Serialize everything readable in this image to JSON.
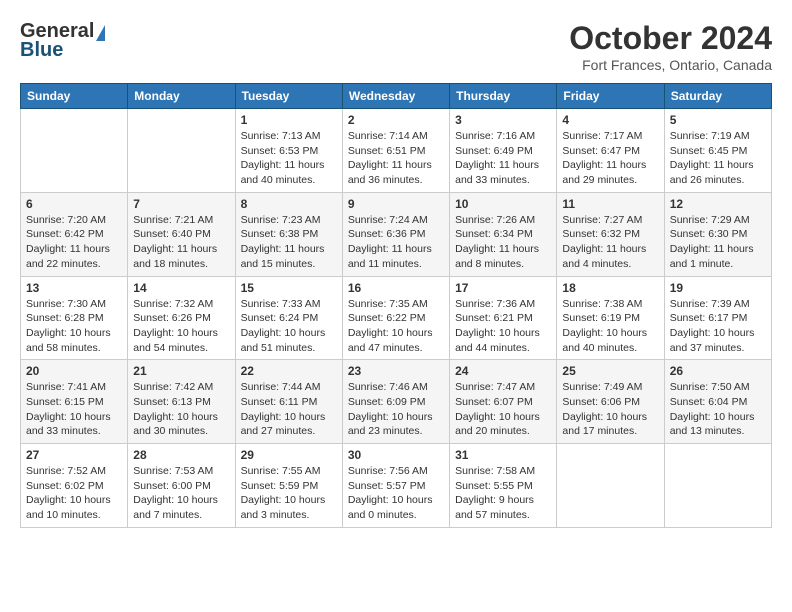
{
  "header": {
    "logo_general": "General",
    "logo_blue": "Blue",
    "month_title": "October 2024",
    "location": "Fort Frances, Ontario, Canada"
  },
  "weekdays": [
    "Sunday",
    "Monday",
    "Tuesday",
    "Wednesday",
    "Thursday",
    "Friday",
    "Saturday"
  ],
  "weeks": [
    [
      {
        "day": "",
        "info": ""
      },
      {
        "day": "",
        "info": ""
      },
      {
        "day": "1",
        "info": "Sunrise: 7:13 AM\nSunset: 6:53 PM\nDaylight: 11 hours and 40 minutes."
      },
      {
        "day": "2",
        "info": "Sunrise: 7:14 AM\nSunset: 6:51 PM\nDaylight: 11 hours and 36 minutes."
      },
      {
        "day": "3",
        "info": "Sunrise: 7:16 AM\nSunset: 6:49 PM\nDaylight: 11 hours and 33 minutes."
      },
      {
        "day": "4",
        "info": "Sunrise: 7:17 AM\nSunset: 6:47 PM\nDaylight: 11 hours and 29 minutes."
      },
      {
        "day": "5",
        "info": "Sunrise: 7:19 AM\nSunset: 6:45 PM\nDaylight: 11 hours and 26 minutes."
      }
    ],
    [
      {
        "day": "6",
        "info": "Sunrise: 7:20 AM\nSunset: 6:42 PM\nDaylight: 11 hours and 22 minutes."
      },
      {
        "day": "7",
        "info": "Sunrise: 7:21 AM\nSunset: 6:40 PM\nDaylight: 11 hours and 18 minutes."
      },
      {
        "day": "8",
        "info": "Sunrise: 7:23 AM\nSunset: 6:38 PM\nDaylight: 11 hours and 15 minutes."
      },
      {
        "day": "9",
        "info": "Sunrise: 7:24 AM\nSunset: 6:36 PM\nDaylight: 11 hours and 11 minutes."
      },
      {
        "day": "10",
        "info": "Sunrise: 7:26 AM\nSunset: 6:34 PM\nDaylight: 11 hours and 8 minutes."
      },
      {
        "day": "11",
        "info": "Sunrise: 7:27 AM\nSunset: 6:32 PM\nDaylight: 11 hours and 4 minutes."
      },
      {
        "day": "12",
        "info": "Sunrise: 7:29 AM\nSunset: 6:30 PM\nDaylight: 11 hours and 1 minute."
      }
    ],
    [
      {
        "day": "13",
        "info": "Sunrise: 7:30 AM\nSunset: 6:28 PM\nDaylight: 10 hours and 58 minutes."
      },
      {
        "day": "14",
        "info": "Sunrise: 7:32 AM\nSunset: 6:26 PM\nDaylight: 10 hours and 54 minutes."
      },
      {
        "day": "15",
        "info": "Sunrise: 7:33 AM\nSunset: 6:24 PM\nDaylight: 10 hours and 51 minutes."
      },
      {
        "day": "16",
        "info": "Sunrise: 7:35 AM\nSunset: 6:22 PM\nDaylight: 10 hours and 47 minutes."
      },
      {
        "day": "17",
        "info": "Sunrise: 7:36 AM\nSunset: 6:21 PM\nDaylight: 10 hours and 44 minutes."
      },
      {
        "day": "18",
        "info": "Sunrise: 7:38 AM\nSunset: 6:19 PM\nDaylight: 10 hours and 40 minutes."
      },
      {
        "day": "19",
        "info": "Sunrise: 7:39 AM\nSunset: 6:17 PM\nDaylight: 10 hours and 37 minutes."
      }
    ],
    [
      {
        "day": "20",
        "info": "Sunrise: 7:41 AM\nSunset: 6:15 PM\nDaylight: 10 hours and 33 minutes."
      },
      {
        "day": "21",
        "info": "Sunrise: 7:42 AM\nSunset: 6:13 PM\nDaylight: 10 hours and 30 minutes."
      },
      {
        "day": "22",
        "info": "Sunrise: 7:44 AM\nSunset: 6:11 PM\nDaylight: 10 hours and 27 minutes."
      },
      {
        "day": "23",
        "info": "Sunrise: 7:46 AM\nSunset: 6:09 PM\nDaylight: 10 hours and 23 minutes."
      },
      {
        "day": "24",
        "info": "Sunrise: 7:47 AM\nSunset: 6:07 PM\nDaylight: 10 hours and 20 minutes."
      },
      {
        "day": "25",
        "info": "Sunrise: 7:49 AM\nSunset: 6:06 PM\nDaylight: 10 hours and 17 minutes."
      },
      {
        "day": "26",
        "info": "Sunrise: 7:50 AM\nSunset: 6:04 PM\nDaylight: 10 hours and 13 minutes."
      }
    ],
    [
      {
        "day": "27",
        "info": "Sunrise: 7:52 AM\nSunset: 6:02 PM\nDaylight: 10 hours and 10 minutes."
      },
      {
        "day": "28",
        "info": "Sunrise: 7:53 AM\nSunset: 6:00 PM\nDaylight: 10 hours and 7 minutes."
      },
      {
        "day": "29",
        "info": "Sunrise: 7:55 AM\nSunset: 5:59 PM\nDaylight: 10 hours and 3 minutes."
      },
      {
        "day": "30",
        "info": "Sunrise: 7:56 AM\nSunset: 5:57 PM\nDaylight: 10 hours and 0 minutes."
      },
      {
        "day": "31",
        "info": "Sunrise: 7:58 AM\nSunset: 5:55 PM\nDaylight: 9 hours and 57 minutes."
      },
      {
        "day": "",
        "info": ""
      },
      {
        "day": "",
        "info": ""
      }
    ]
  ]
}
